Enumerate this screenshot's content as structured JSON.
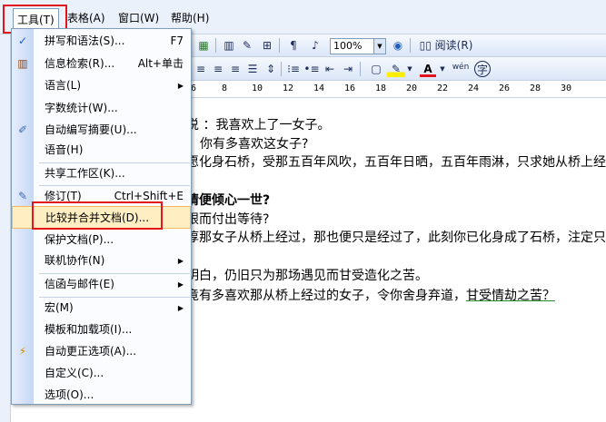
{
  "menubar": {
    "items": [
      {
        "label": "工具(T)",
        "active": true
      },
      {
        "label": "表格(A)"
      },
      {
        "label": "窗口(W)"
      },
      {
        "label": "帮助(H)"
      }
    ]
  },
  "toolbar": {
    "zoom": "100%",
    "read_label": "阅读(R)",
    "style_glyph": "A",
    "font_color_glyph": "A",
    "pinyin_glyph": "wén",
    "enclose_glyph": "字"
  },
  "ruler": [
    "6",
    "8",
    "10",
    "12",
    "14",
    "16",
    "18",
    "20",
    "22",
    "24",
    "26",
    "28",
    "30"
  ],
  "document": {
    "lines": [
      "说 ：我喜欢上了一女子。",
      "你有多喜欢这女子?",
      "愿化身石桥，受那五百年风吹，五百年日晒，五百年雨淋，只求她从桥上经",
      "情便倾心一世?",
      "眼而付出等待?",
      "淳那女子从桥上经过，那也便只是经过了，此刻你已化身成了石桥，注定只与",
      "明白，仍旧只为那场遇见而甘受造化之苦。",
      "竟有多喜欢那从桥上经过的女子，令你舍身弃道，",
      "甘受情劫之苦？"
    ]
  },
  "tools_menu": {
    "items": [
      {
        "label": "拼写和语法(S)...",
        "shortcut": "F7",
        "icon": "spelling-check-icon"
      },
      {
        "label": "信息检索(R)...",
        "shortcut": "Alt+单击",
        "icon": "research-books-icon"
      },
      {
        "label": "语言(L)",
        "submenu": true
      },
      {
        "label": "字数统计(W)..."
      },
      {
        "label": "自动编写摘要(U)...",
        "icon": "autosummarize-icon"
      },
      {
        "label": "语音(H)"
      },
      {
        "label": "共享工作区(K)..."
      },
      {
        "label": "修订(T)",
        "shortcut": "Ctrl+Shift+E",
        "icon": "track-changes-icon"
      },
      {
        "label": "比较并合并文档(D)...",
        "highlighted": true
      },
      {
        "label": "保护文档(P)..."
      },
      {
        "label": "联机协作(N)",
        "submenu": true
      },
      {
        "label": "信函与邮件(E)",
        "submenu": true
      },
      {
        "label": "宏(M)",
        "submenu": true
      },
      {
        "label": "模板和加载项(I)..."
      },
      {
        "label": "自动更正选项(A)...",
        "icon": "autocorrect-icon"
      },
      {
        "label": "自定义(C)..."
      },
      {
        "label": "选项(O)..."
      }
    ],
    "submenu_arrow": "▶"
  },
  "colors": {
    "highlight_box": "#e3151b",
    "menu_hover": "#ffeec2",
    "toolbar": "#dbe6f7"
  }
}
